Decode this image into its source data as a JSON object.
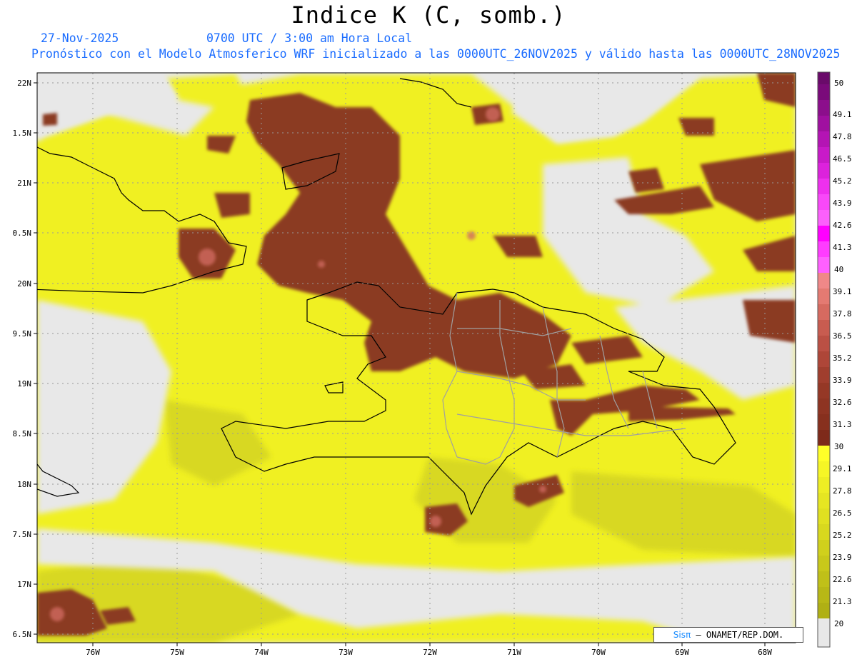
{
  "header": {
    "title": "Indice K (C, somb.)",
    "date": "27-Nov-2025",
    "time": "0700 UTC / 3:00 am Hora Local",
    "description": "Pronóstico con el Modelo Atmosferico WRF inicializado a las 0000UTC_26NOV2025 y válido hasta las  0000UTC_28NOV2025"
  },
  "map": {
    "lat_labels": [
      "22N",
      "1.5N",
      "21N",
      "0.5N",
      "20N",
      "9.5N",
      "19N",
      "8.5N",
      "18N",
      "7.5N",
      "17N",
      "6.5N"
    ],
    "lon_labels": [
      "76W",
      "75W",
      "74W",
      "73W",
      "72W",
      "71W",
      "70W",
      "69W",
      "68W"
    ],
    "colors": {
      "land_background": "#e8e8e8",
      "low": "#e6e63a",
      "yellow": "#f0f020",
      "brown": "#8b3a22",
      "pink": "#d06a60"
    }
  },
  "colorbar": {
    "labels": [
      "50",
      "49.1",
      "47.8",
      "46.5",
      "45.2",
      "43.9",
      "42.6",
      "41.3",
      "40",
      "39.1",
      "37.8",
      "36.5",
      "35.2",
      "33.9",
      "32.6",
      "31.3",
      "30",
      "29.1",
      "27.8",
      "26.5",
      "25.2",
      "23.9",
      "22.6",
      "21.3",
      "20"
    ]
  },
  "credit": {
    "brand": "Sisπ",
    "text": "– ONAMET/REP.DOM."
  }
}
